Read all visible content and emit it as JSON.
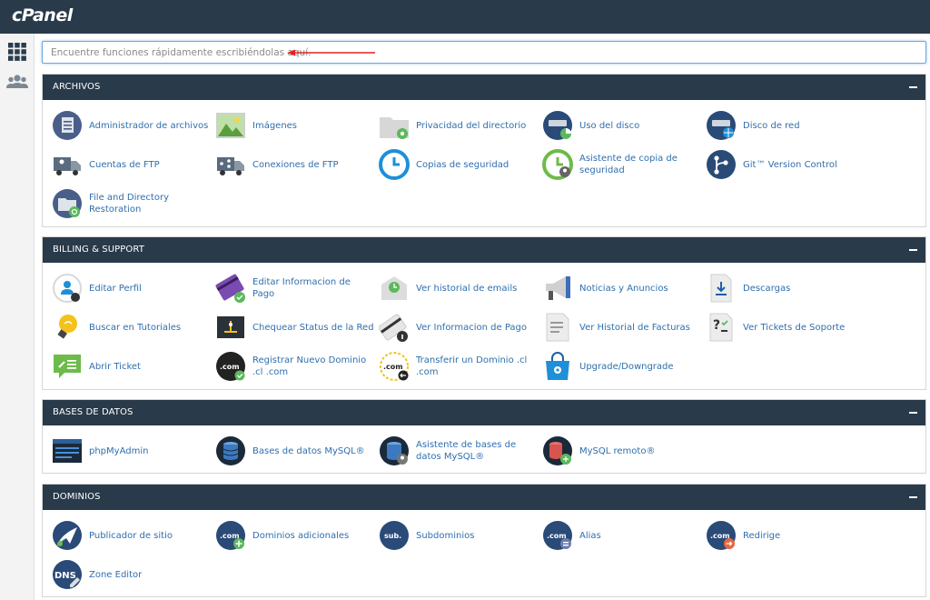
{
  "app": {
    "logo": "cPanel"
  },
  "search": {
    "placeholder": "Encuentre funciones rápidamente escribiéndolas aquí."
  },
  "sections": {
    "archivos": {
      "title": "ARCHIVOS",
      "items": [
        {
          "label": "Administrador de archivos",
          "icon": "file-manager-icon"
        },
        {
          "label": "Imágenes",
          "icon": "images-icon"
        },
        {
          "label": "Privacidad del directorio",
          "icon": "directory-privacy-icon"
        },
        {
          "label": "Uso del disco",
          "icon": "disk-usage-icon"
        },
        {
          "label": "Disco de red",
          "icon": "network-disk-icon"
        },
        {
          "label": "Cuentas de FTP",
          "icon": "ftp-accounts-icon"
        },
        {
          "label": "Conexiones de FTP",
          "icon": "ftp-connections-icon"
        },
        {
          "label": "Copias de seguridad",
          "icon": "backup-icon"
        },
        {
          "label": "Asistente de copia de seguridad",
          "icon": "backup-wizard-icon"
        },
        {
          "label": "Git™ Version Control",
          "icon": "git-icon"
        },
        {
          "label": "File and Directory Restoration",
          "icon": "file-restoration-icon"
        }
      ]
    },
    "billing": {
      "title": "BILLING & SUPPORT",
      "items": [
        {
          "label": "Editar Perfil",
          "icon": "edit-profile-icon"
        },
        {
          "label": "Editar Informacion de Pago",
          "icon": "payment-card-icon"
        },
        {
          "label": "Ver historial de emails",
          "icon": "email-history-icon"
        },
        {
          "label": "Noticias y Anuncios",
          "icon": "megaphone-icon"
        },
        {
          "label": "Descargas",
          "icon": "downloads-icon"
        },
        {
          "label": "Buscar en Tutoriales",
          "icon": "lightbulb-icon"
        },
        {
          "label": "Chequear Status de la Red",
          "icon": "network-status-icon"
        },
        {
          "label": "Ver Informacion de Pago",
          "icon": "payment-info-icon"
        },
        {
          "label": "Ver Historial de Facturas",
          "icon": "invoices-icon"
        },
        {
          "label": "Ver Tickets de Soporte",
          "icon": "support-tickets-icon"
        },
        {
          "label": "Abrir Ticket",
          "icon": "open-ticket-icon"
        },
        {
          "label": "Registrar Nuevo Dominio .cl .com",
          "icon": "register-domain-icon"
        },
        {
          "label": "Transferir un Dominio .cl .com",
          "icon": "transfer-domain-icon"
        },
        {
          "label": "Upgrade/Downgrade",
          "icon": "upgrade-icon"
        }
      ]
    },
    "bases": {
      "title": "BASES DE DATOS",
      "items": [
        {
          "label": "phpMyAdmin",
          "icon": "phpmyadmin-icon"
        },
        {
          "label": "Bases de datos MySQL®",
          "icon": "mysql-databases-icon"
        },
        {
          "label": "Asistente de bases de datos MySQL®",
          "icon": "mysql-wizard-icon"
        },
        {
          "label": "MySQL remoto®",
          "icon": "remote-mysql-icon"
        }
      ]
    },
    "dominios": {
      "title": "DOMINIOS",
      "items": [
        {
          "label": "Publicador de sitio",
          "icon": "site-publisher-icon"
        },
        {
          "label": "Dominios adicionales",
          "icon": "addon-domains-icon"
        },
        {
          "label": "Subdominios",
          "icon": "subdomains-icon"
        },
        {
          "label": "Alias",
          "icon": "alias-icon"
        },
        {
          "label": "Redirige",
          "icon": "redirects-icon"
        },
        {
          "label": "Zone Editor",
          "icon": "zone-editor-icon"
        }
      ]
    }
  },
  "icon_text": {
    "com": ".com",
    "sub": "sub.",
    "dns": "DNS"
  },
  "colors": {
    "header": "#293a4a",
    "link": "#2f6fae",
    "accent_green": "#5cb85c",
    "accent_blue": "#1f8fd8"
  }
}
